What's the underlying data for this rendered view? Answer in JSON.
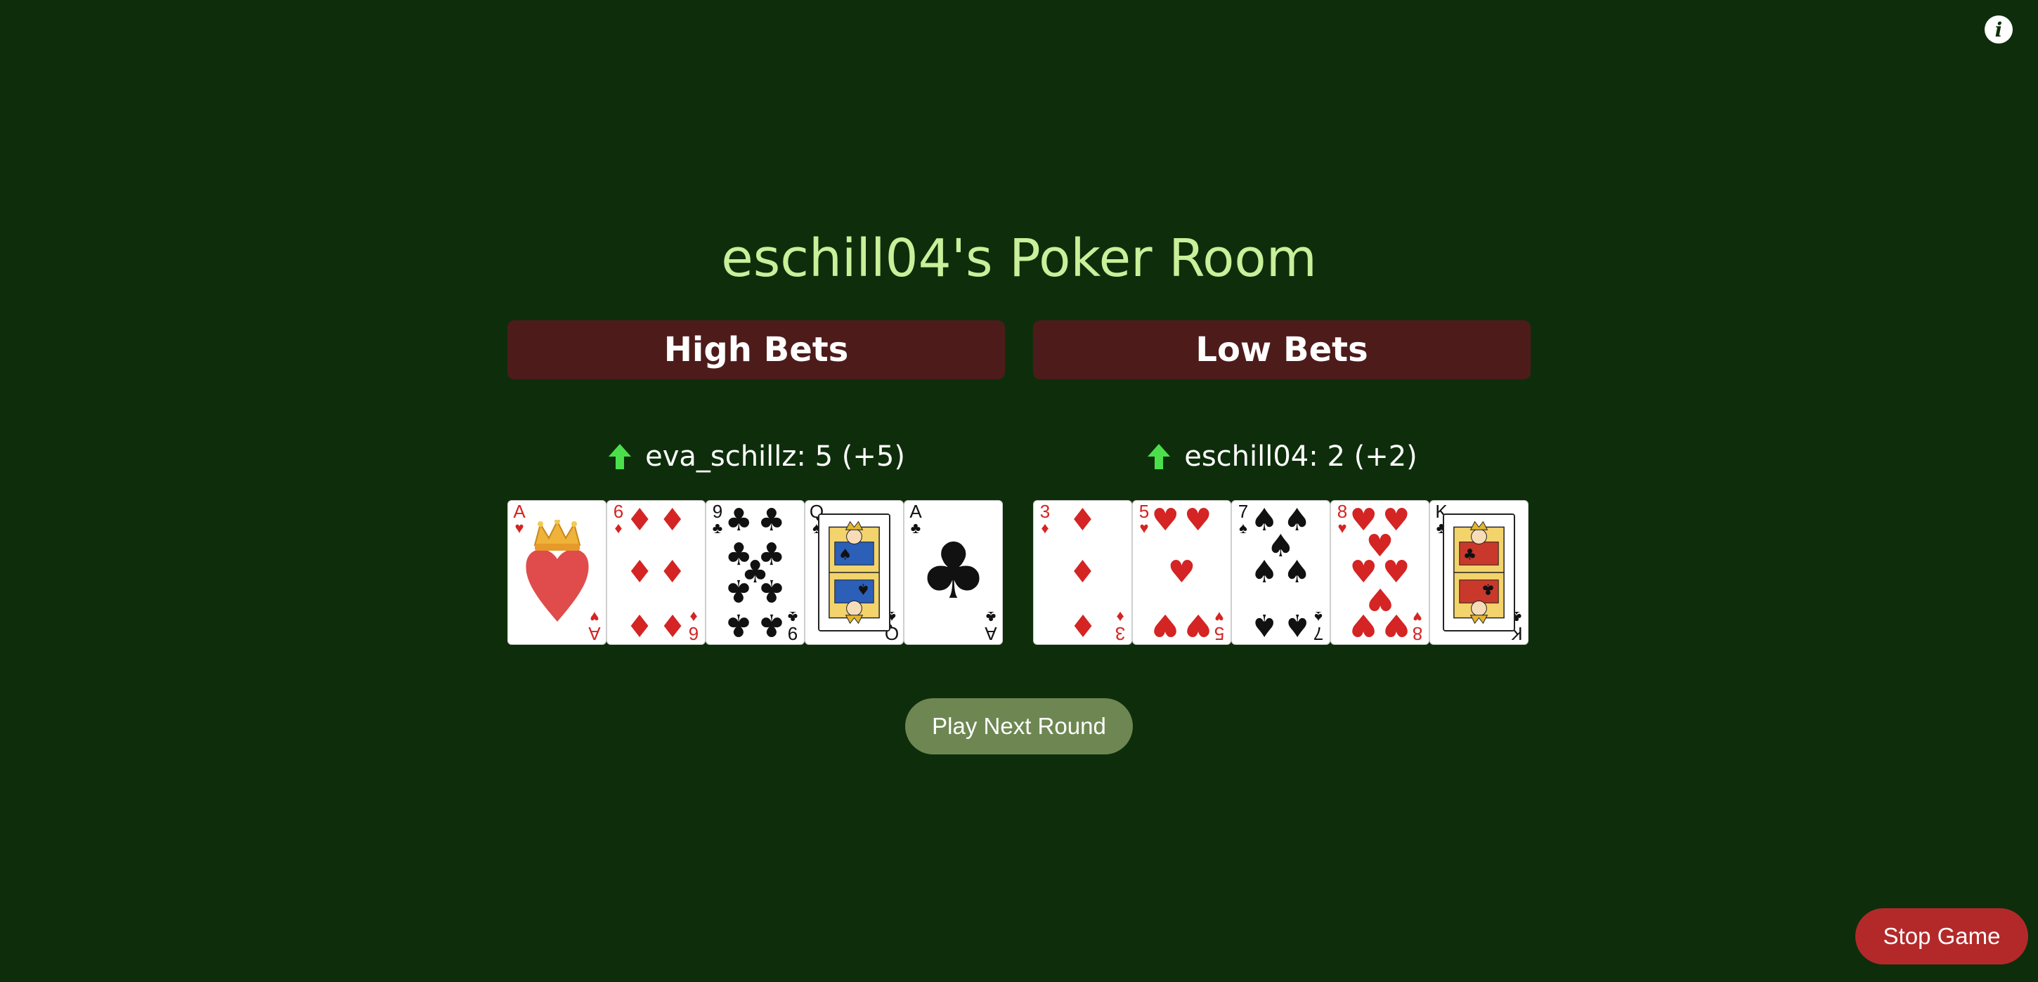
{
  "room": {
    "title": "eschill04's Poker Room"
  },
  "colors": {
    "background": "#0e2e0b",
    "title": "#c9f09a",
    "bet_header": "#4e1b1b",
    "arrow": "#4be04b",
    "next_button": "#6e8752",
    "stop_button": "#b3292a",
    "red_suit": "#d42424"
  },
  "high_bets": {
    "label": "High Bets",
    "player": {
      "text": "eva_schillz: 5 (+5)",
      "trend_icon": "arrow-up-icon"
    },
    "cards": [
      {
        "rank": "A",
        "suit": "♥",
        "color": "red"
      },
      {
        "rank": "6",
        "suit": "♦",
        "color": "red"
      },
      {
        "rank": "9",
        "suit": "♣",
        "color": "black"
      },
      {
        "rank": "Q",
        "suit": "♠",
        "color": "black"
      },
      {
        "rank": "A",
        "suit": "♣",
        "color": "black"
      }
    ]
  },
  "low_bets": {
    "label": "Low Bets",
    "player": {
      "text": "eschill04: 2 (+2)",
      "trend_icon": "arrow-up-icon"
    },
    "cards": [
      {
        "rank": "3",
        "suit": "♦",
        "color": "red"
      },
      {
        "rank": "5",
        "suit": "♥",
        "color": "red"
      },
      {
        "rank": "7",
        "suit": "♠",
        "color": "black"
      },
      {
        "rank": "8",
        "suit": "♥",
        "color": "red"
      },
      {
        "rank": "K",
        "suit": "♣",
        "color": "black"
      }
    ]
  },
  "buttons": {
    "next_round": "Play Next Round",
    "stop_game": "Stop Game",
    "info_icon": "info-icon"
  }
}
